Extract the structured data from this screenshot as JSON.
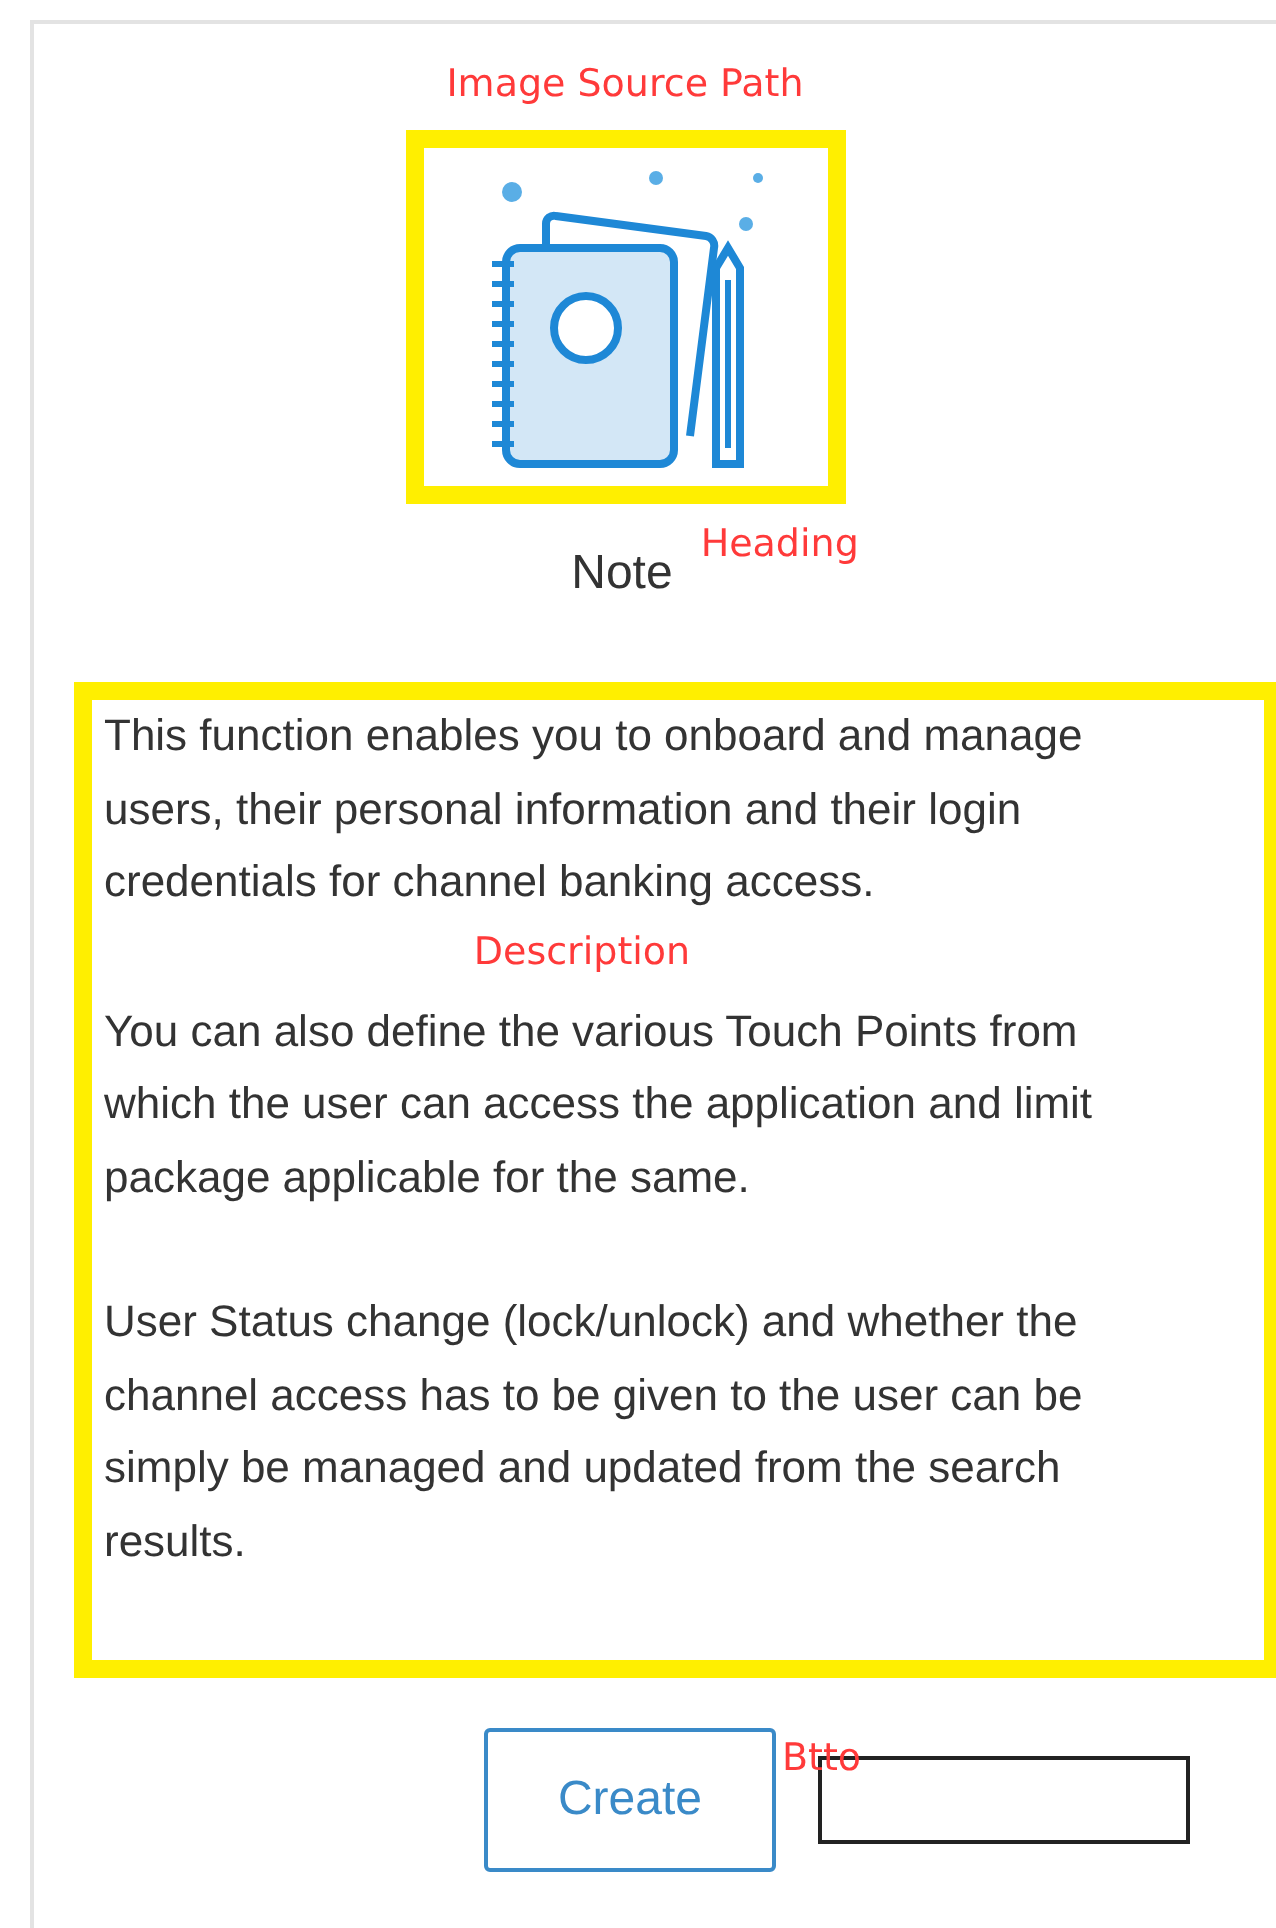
{
  "image_section": {
    "annotation": "Image Source Path"
  },
  "heading": {
    "text": "Note",
    "annotation": "Heading"
  },
  "description": {
    "annotation": "Description",
    "paragraphs": [
      "This function enables you to onboard and manage users, their personal information and their login credentials for channel banking access.",
      "You can also define the various Touch Points from which the user can access the application and limit package applicable for the same.",
      "User Status change (lock/unlock) and whether the channel access has to be given to the user can be simply be managed and updated from the search results."
    ]
  },
  "button": {
    "label": "Create",
    "annotation": "Btto"
  }
}
